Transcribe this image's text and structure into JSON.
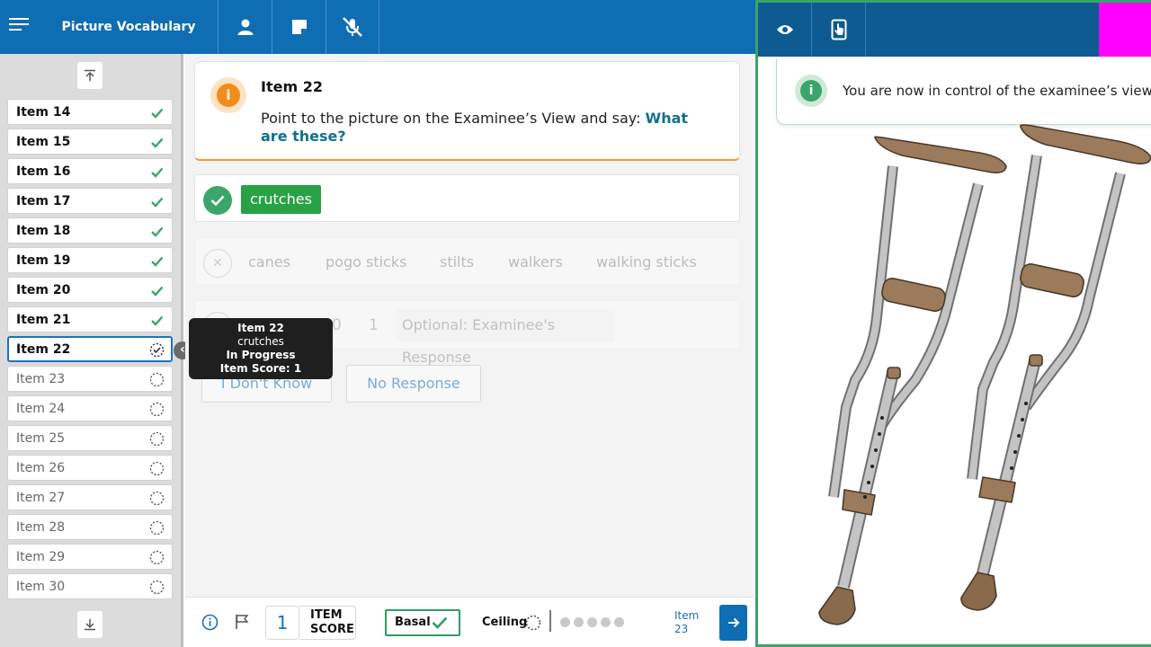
{
  "header": {
    "app_title": "Picture Vocabulary",
    "icons": [
      "menu-icon",
      "examinee-icon",
      "notes-icon",
      "mic-muted-icon"
    ]
  },
  "examinee_panel": {
    "icons": [
      "eye-icon",
      "tablet-touch-icon"
    ],
    "highlight_color": "#ff00ff",
    "message": "You are now in control of the examinee’s view",
    "picture": "two crutches"
  },
  "sidebar": {
    "items": [
      {
        "label": "Item 14",
        "status": "complete"
      },
      {
        "label": "Item 15",
        "status": "complete"
      },
      {
        "label": "Item 16",
        "status": "complete"
      },
      {
        "label": "Item 17",
        "status": "complete"
      },
      {
        "label": "Item 18",
        "status": "complete"
      },
      {
        "label": "Item 19",
        "status": "complete"
      },
      {
        "label": "Item 20",
        "status": "complete"
      },
      {
        "label": "Item 21",
        "status": "complete"
      },
      {
        "label": "Item 22",
        "status": "in-progress"
      },
      {
        "label": "Item 23",
        "status": "not-started"
      },
      {
        "label": "Item 24",
        "status": "not-started"
      },
      {
        "label": "Item 25",
        "status": "not-started"
      },
      {
        "label": "Item 26",
        "status": "not-started"
      },
      {
        "label": "Item 27",
        "status": "not-started"
      },
      {
        "label": "Item 28",
        "status": "not-started"
      },
      {
        "label": "Item 29",
        "status": "not-started"
      },
      {
        "label": "Item 30",
        "status": "not-started"
      }
    ]
  },
  "tooltip": {
    "title": "Item 22",
    "answer": "crutches",
    "status": "In Progress",
    "score": "Item Score: 1"
  },
  "question": {
    "title": "Item 22",
    "prompt": "Point to the picture on the Examinee’s View and say: ",
    "prompt_emphasis": "What are these?"
  },
  "correct_answers": [
    "crutches"
  ],
  "incorrect_answers": [
    "canes",
    "pogo sticks",
    "stilts",
    "walkers",
    "walking sticks"
  ],
  "scoring": {
    "zero": "0",
    "one": "1",
    "response_placeholder": "Optional: Examinee's Response"
  },
  "buttons": {
    "dont_know": "I Don't Know",
    "no_response": "No Response"
  },
  "footer": {
    "item_score_value": "1",
    "item_score_line1": "ITEM",
    "item_score_line2": "SCORE",
    "basal_label": "Basal",
    "ceiling_label": "Ceiling",
    "next_line1": "Item",
    "next_line2": "23"
  },
  "colors": {
    "header_blue": "#0f6db3",
    "right_header": "#0d5b91",
    "correct_green": "#27a244",
    "accent_orange": "#f28c1b",
    "panel_border_green": "#39a36a"
  }
}
